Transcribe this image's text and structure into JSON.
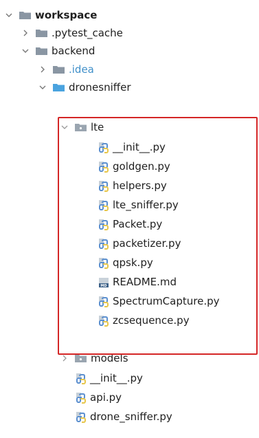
{
  "tree": {
    "rows": [
      {
        "label": "workspace",
        "kind": "folder",
        "state": "expanded",
        "bold": true
      },
      {
        "label": ".pytest_cache",
        "kind": "folder",
        "state": "collapsed"
      },
      {
        "label": "backend",
        "kind": "folder",
        "state": "expanded"
      },
      {
        "label": ".idea",
        "kind": "folder",
        "state": "collapsed"
      },
      {
        "label": "dronesniffer",
        "kind": "folder",
        "state": "expanded"
      },
      {
        "label": "lte",
        "kind": "folder",
        "state": "expanded"
      },
      {
        "label": "__init__.py",
        "kind": "py"
      },
      {
        "label": "goldgen.py",
        "kind": "py"
      },
      {
        "label": "helpers.py",
        "kind": "py"
      },
      {
        "label": "lte_sniffer.py",
        "kind": "py"
      },
      {
        "label": "Packet.py",
        "kind": "py"
      },
      {
        "label": "packetizer.py",
        "kind": "py"
      },
      {
        "label": "qpsk.py",
        "kind": "py"
      },
      {
        "label": "README.md",
        "kind": "md"
      },
      {
        "label": "SpectrumCapture.py",
        "kind": "py"
      },
      {
        "label": "zcsequence.py",
        "kind": "py"
      },
      {
        "label": "models",
        "kind": "folder",
        "state": "collapsed"
      },
      {
        "label": "__init__.py",
        "kind": "py"
      },
      {
        "label": "api.py",
        "kind": "py"
      },
      {
        "label": "drone_sniffer.py",
        "kind": "py"
      }
    ]
  },
  "colors": {
    "folder_gray": "#8a96a3",
    "folder_blue": "#4aa3df",
    "idea_text": "#3f8fc9",
    "highlight_border": "#d42525",
    "py_blue": "#5b8fcf",
    "py_yellow": "#e7c64a"
  }
}
